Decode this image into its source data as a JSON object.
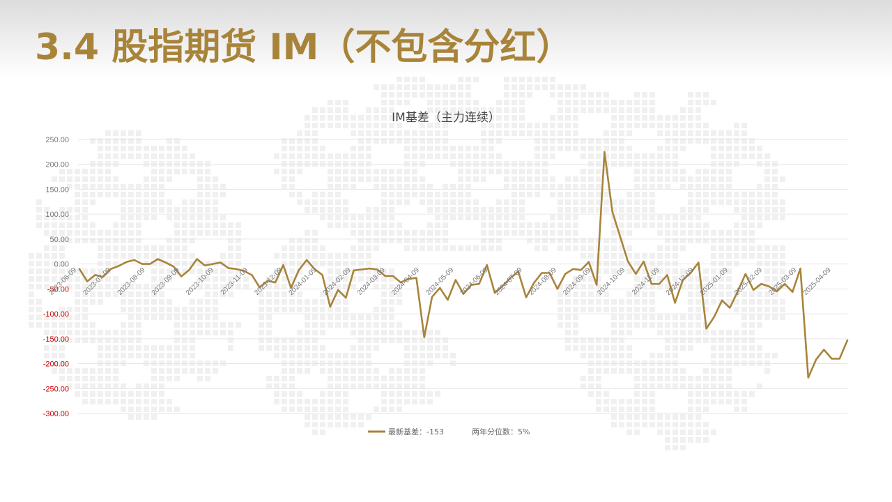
{
  "slide": {
    "title": "3.4 股指期货 IM（不包含分红）"
  },
  "colors": {
    "title": "#a8843a",
    "series": "#a8843a",
    "positive_tick": "#777777",
    "negative_tick": "#cc0000",
    "grid": "#e6e6e6"
  },
  "chart_data": {
    "type": "line",
    "title": "IM基差（主力连续）",
    "xlabel": "",
    "ylabel": "",
    "ylim": [
      -300,
      250
    ],
    "yticks": [
      "250.00",
      "200.00",
      "150.00",
      "100.00",
      "50.00",
      "0.00",
      "-50.00",
      "-100.00",
      "-150.00",
      "-200.00",
      "-250.00",
      "-300.00"
    ],
    "grid": "horizontal",
    "xticks": [
      "2023-06-09",
      "2023-07-09",
      "2023-08-09",
      "2023-09-09",
      "2023-10-09",
      "2023-11-09",
      "2023-12-09",
      "2024-01-09",
      "2024-02-09",
      "2024-03-09",
      "2024-04-09",
      "2024-05-09",
      "2024-06-09",
      "2024-07-09",
      "2024-08-09",
      "2024-09-09",
      "2024-10-09",
      "2024-11-09",
      "2024-12-09",
      "2025-01-09",
      "2025-02-09",
      "2025-03-09",
      "2025-04-09"
    ],
    "legend": {
      "placement": "bottom",
      "entries": [
        "最新基差：-153",
        "两年分位数：5%"
      ]
    },
    "series": [
      {
        "values": [
          -10,
          -35,
          -22,
          -26,
          -10,
          -4,
          4,
          8,
          0,
          0,
          10,
          3,
          -5,
          -25,
          -12,
          10,
          -3,
          0,
          3,
          -8,
          -10,
          -14,
          -22,
          -47,
          -34,
          -37,
          -2,
          -48,
          -12,
          8,
          -10,
          -22,
          -86,
          -52,
          -68,
          -13,
          -11,
          -9,
          -11,
          -24,
          -24,
          -37,
          -30,
          -28,
          -147,
          -66,
          -48,
          -72,
          -32,
          -60,
          -42,
          -40,
          -2,
          -58,
          -44,
          -28,
          -15,
          -67,
          -38,
          -18,
          -18,
          -50,
          -20,
          -10,
          -12,
          4,
          -42,
          225,
          105,
          55,
          5,
          -20,
          5,
          -40,
          -40,
          -22,
          -78,
          -32,
          -18,
          3,
          -130,
          -106,
          -73,
          -88,
          -55,
          -20,
          -52,
          -40,
          -45,
          -55,
          -40,
          -56,
          -9,
          -228,
          -192,
          -172,
          -190,
          -190,
          -153
        ]
      }
    ]
  }
}
